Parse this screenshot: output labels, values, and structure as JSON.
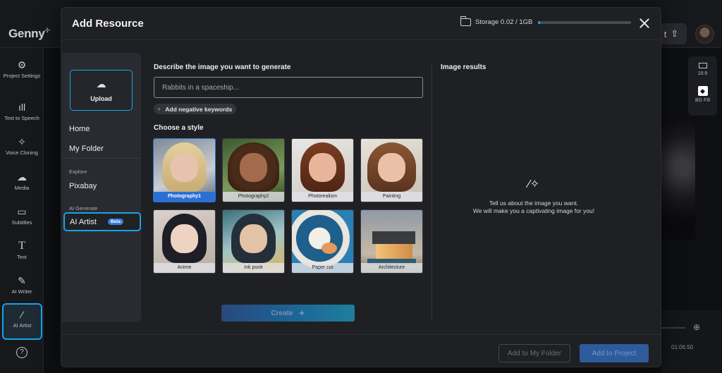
{
  "app": {
    "logo": "Genny",
    "export_label": "t",
    "rail": [
      {
        "icon": "settings-icon",
        "label": "Project Settings"
      },
      {
        "icon": "waveform-icon",
        "label": "Text to Speech"
      },
      {
        "icon": "voice-clone-icon",
        "label": "Voice Cloning"
      },
      {
        "icon": "cloud-icon",
        "label": "Media"
      },
      {
        "icon": "subtitles-icon",
        "label": "Subtitles"
      },
      {
        "icon": "text-icon",
        "label": "Text"
      },
      {
        "icon": "pen-icon",
        "label": "AI Writer"
      },
      {
        "icon": "magic-wand-icon",
        "label": "AI Artist"
      },
      {
        "icon": "help-icon",
        "label": "?"
      }
    ],
    "right_panel": {
      "aspect": "16:9",
      "bg_fill": "BG Fill"
    },
    "timeline_time": "01:06.50"
  },
  "modal": {
    "title": "Add Resource",
    "storage": {
      "label": "Storage 0.02 / 1GB",
      "used_fraction": 0.02
    },
    "nav": {
      "upload": "Upload",
      "home": "Home",
      "my_folder": "My Folder",
      "explore_section": "Explore",
      "pixabay": "Pixabay",
      "ai_section": "AI Generate",
      "ai_artist": "AI Artist",
      "beta": "Beta"
    },
    "describe_label": "Describe the image you want to generate",
    "prompt_placeholder": "Rabbits in a spaceship...",
    "negative_keywords": "Add negative keywords",
    "choose_style_label": "Choose a style",
    "styles": [
      {
        "name": "Photography1",
        "selected": true
      },
      {
        "name": "Photography2",
        "selected": false
      },
      {
        "name": "Photorealism",
        "selected": false
      },
      {
        "name": "Painting",
        "selected": false
      },
      {
        "name": "Anime",
        "selected": false
      },
      {
        "name": "Ink punk",
        "selected": false
      },
      {
        "name": "Paper cut",
        "selected": false
      },
      {
        "name": "Architecture",
        "selected": false
      }
    ],
    "create_label": "Create",
    "results_label": "Image results",
    "results_empty_line1": "Tell us about the image you want.",
    "results_empty_line2": "We will make you a captivating image for you!",
    "add_to_folder": "Add to My Folder",
    "add_to_project": "Add to Project"
  },
  "colors": {
    "accent": "#18a3e6",
    "selected_style": "#2c6fd3",
    "beta": "#3a7bd5"
  }
}
